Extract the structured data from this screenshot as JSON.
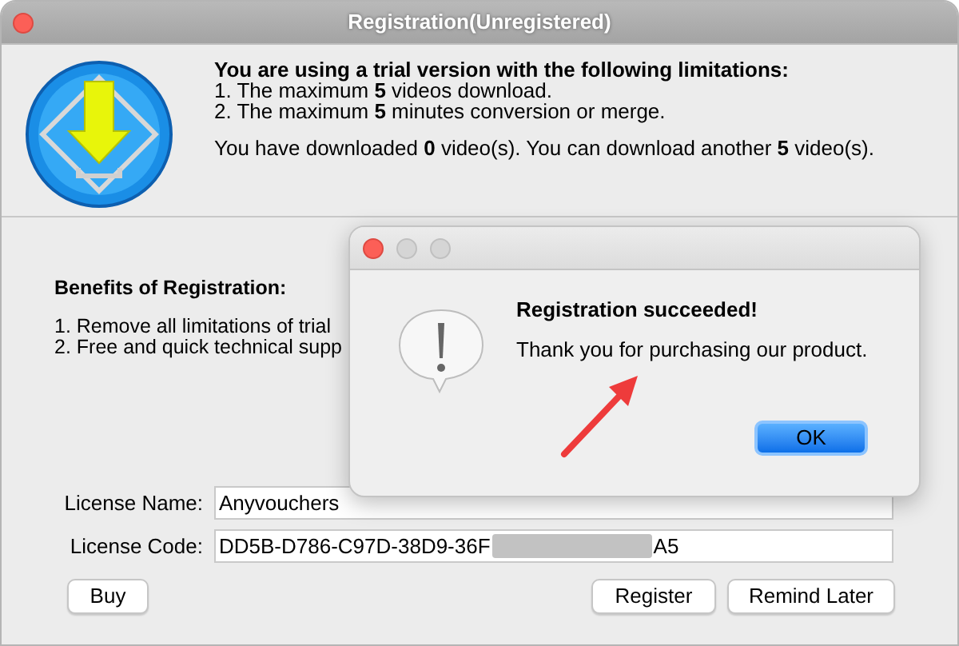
{
  "window": {
    "title": "Registration(Unregistered)"
  },
  "trial_info": {
    "heading": "You are using a trial version with the following limitations:",
    "limitations": [
      "1. The maximum **5** videos download.",
      "2. The maximum **5** minutes conversion or merge."
    ],
    "downloads": "You have downloaded **0** video(s). You can download another **5** video(s)."
  },
  "benefits": {
    "heading": "Benefits of Registration:",
    "items": [
      "1. Remove all limitations of trial",
      "2. Free and quick technical supp"
    ]
  },
  "license_name": {
    "label": "License Name:",
    "value": "Anyvouchers"
  },
  "license_code": {
    "label": "License Code:",
    "value_start": "DD5B-D786-C97D-38D9-36F",
    "value_end": "A5",
    "redacted": true
  },
  "buttons": [
    {
      "label": "Buy"
    },
    {
      "label": "Register"
    },
    {
      "label": "Remind Later"
    }
  ],
  "dialog": {
    "heading": "Registration succeeded!",
    "message": "Thank you for purchasing our product.",
    "button": "OK"
  }
}
